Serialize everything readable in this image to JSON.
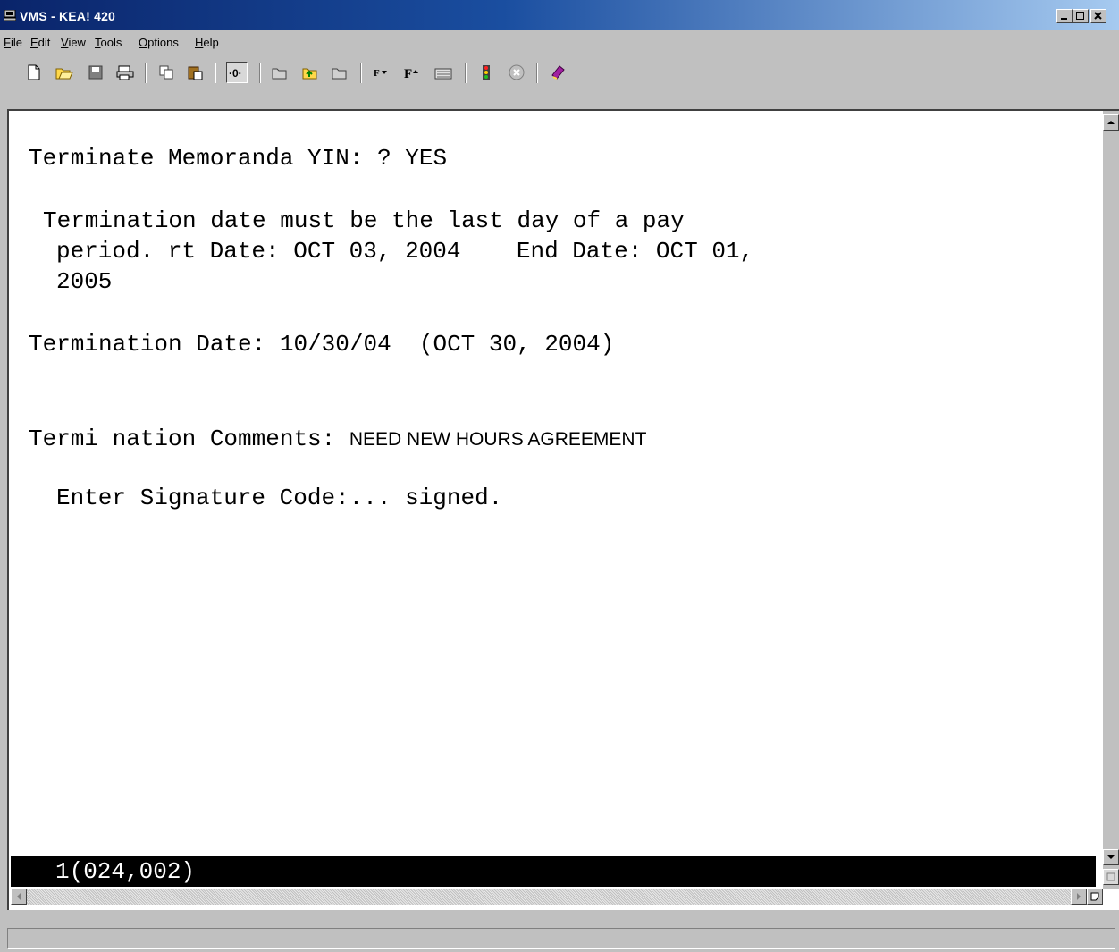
{
  "window": {
    "title": "VMS - KEA! 420"
  },
  "menu": [
    {
      "name": "menu-file",
      "pre": "",
      "u": "F",
      "post": "ile"
    },
    {
      "name": "menu-edit",
      "pre": "",
      "u": "E",
      "post": "dit"
    },
    {
      "name": "menu-view",
      "pre": "",
      "u": "V",
      "post": "iew"
    },
    {
      "name": "menu-tools",
      "pre": "",
      "u": "T",
      "post": "ools"
    },
    {
      "name": "menu-options",
      "pre": "",
      "u": "O",
      "post": "ptions"
    },
    {
      "name": "menu-help",
      "pre": "",
      "u": "H",
      "post": "elp"
    }
  ],
  "toolbar_icons": [
    "new-file-icon",
    "open-folder-icon",
    "save-icon",
    "print-icon",
    "copy-icon",
    "paste-icon",
    "connect-icon",
    "transfer-icon",
    "folder-upload-icon",
    "folder-download-icon",
    "font-down-icon",
    "font-up-icon",
    "keyboard-icon",
    "traffic-light-icon",
    "stop-icon",
    "macro-book-icon"
  ],
  "terminal": {
    "l1": "Terminate Memoranda YIN: ? YES",
    "l2": "Termination date must be the last day of a pay",
    "l3": "period. rt Date: OCT 03, 2004    End Date: OCT 01,",
    "l4": "2005",
    "l5": "Termination Date: 10/30/04  (OCT 30, 2004)",
    "l6_label": "Termi nation Comments: ",
    "l6_value": "NEED NEW HOURS AGREEMENT",
    "l7": "Enter Signature Code:... signed."
  },
  "status_line": "1(024,002)",
  "colors": {
    "titlebar_start": "#0a246a",
    "titlebar_end": "#a6caf0",
    "chrome": "#c0c0c0",
    "terminal_bg": "#ffffff",
    "status_bg": "#000000"
  }
}
